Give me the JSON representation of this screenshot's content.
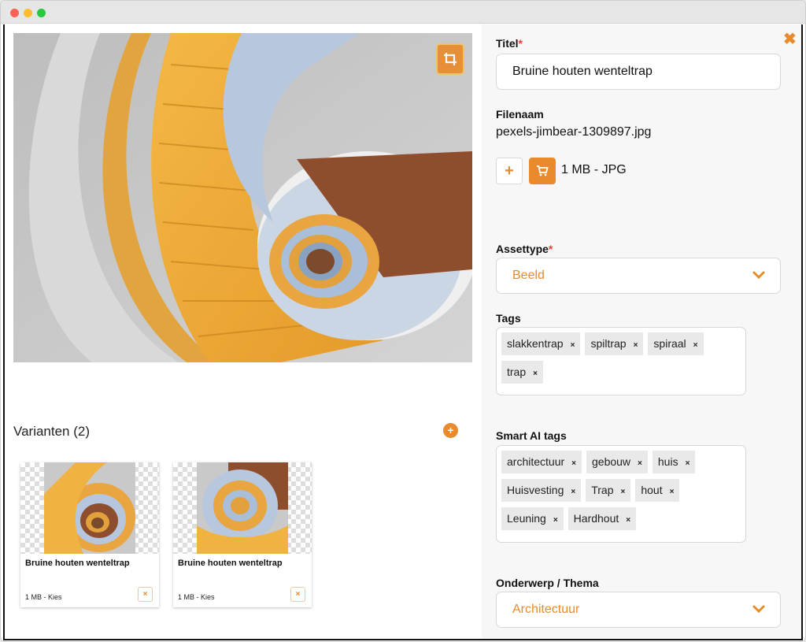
{
  "asset": {
    "title_label": "Titel",
    "title_required": "*",
    "title_value": "Bruine houten wenteltrap",
    "filename_label": "Filenaam",
    "filename_value": "pexels-jimbear-1309897.jpg",
    "add_button_label": "+",
    "file_info": "1 MB - JPG",
    "assettype_label": "Assettype",
    "assettype_required": "*",
    "assettype_value": "Beeld",
    "tags_label": "Tags",
    "tags": [
      "slakkentrap",
      "spiltrap",
      "spiraal",
      "trap"
    ],
    "smart_tags_label": "Smart AI tags",
    "smart_tags": [
      "architectuur",
      "gebouw",
      "huis",
      "Huisvesting",
      "Trap",
      "hout",
      "Leuning",
      "Hardhout"
    ],
    "subject_label": "Onderwerp / Thema",
    "subject_value": "Architectuur",
    "tag_remove_glyph": "×"
  },
  "variants": {
    "title": "Varianten (2)",
    "add_glyph": "+",
    "items": [
      {
        "name": "Bruine houten wenteltrap",
        "meta": "1 MB - Kies",
        "remove_glyph": "×"
      },
      {
        "name": "Bruine houten wenteltrap",
        "meta": "1 MB - Kies",
        "remove_glyph": "×"
      }
    ]
  },
  "close_glyph": "✖",
  "icons": {
    "crop": "crop-icon",
    "cart": "cart-icon",
    "chevron": "chevron-down-icon",
    "close": "close-icon"
  },
  "colors": {
    "accent": "#e98a2c",
    "required": "#e0452e",
    "panel_bg": "#f7f7f7",
    "tag_bg": "#e9e9e9"
  }
}
